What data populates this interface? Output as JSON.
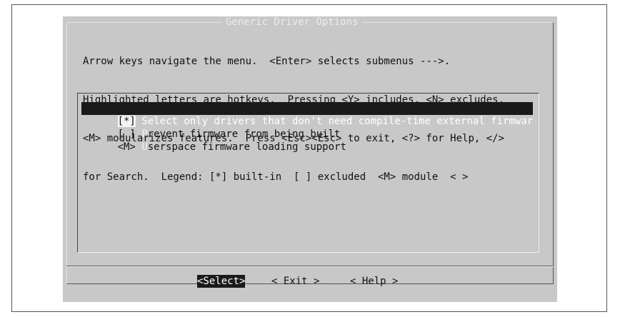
{
  "dialog": {
    "title": "Generic Driver Options",
    "help_lines": [
      "Arrow keys navigate the menu.  <Enter> selects submenus --->.",
      "Highlighted letters are hotkeys.  Pressing <Y> includes, <N> excludes,",
      "<M> modularizes features.  Press <Esc><Esc> to exit, <?> for Help, </>",
      "for Search.  Legend: [*] built-in  [ ] excluded  <M> module  < >"
    ]
  },
  "menu": {
    "items": [
      {
        "state": "[*]",
        "hotkey": "S",
        "rest": "elect only drivers that don't need compile-time external firmwar",
        "selected": true
      },
      {
        "state": "[ ]",
        "hotkey": "P",
        "rest": "revent firmware from being built",
        "selected": false
      },
      {
        "state": "<M>",
        "hotkey": "U",
        "rest": "serspace firmware loading support",
        "selected": false
      }
    ]
  },
  "buttons": {
    "select": "<Select>",
    "exit": "< Exit >",
    "help": "< Help >"
  }
}
